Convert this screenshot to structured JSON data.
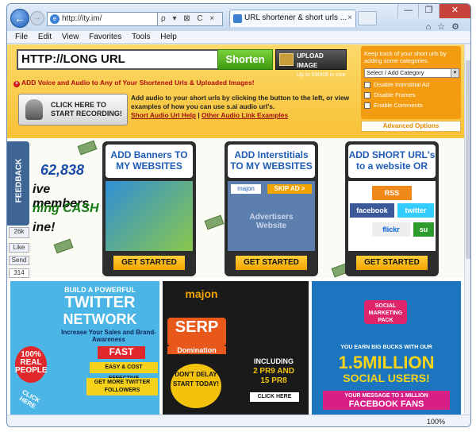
{
  "browser": {
    "address": "http://ity.im/",
    "tab_title": "URL shortener & short urls ...",
    "address_buttons": "ρ ▾ ⊠ C ×",
    "window_controls": [
      "—",
      "❐",
      "✕"
    ],
    "menu": [
      "File",
      "Edit",
      "View",
      "Favorites",
      "Tools",
      "Help"
    ],
    "zoom": "100%"
  },
  "header": {
    "url_input_value": "HTTP://LONG URL",
    "shorten_label": "Shorten",
    "upload_title": "UPLOAD IMAGE",
    "upload_sub": "Up to 500KB in size",
    "add_voice": "ADD Voice and Audio to Any of Your Shortened Urls & Uploaded Images!",
    "record_line1": "CLICK HERE TO",
    "record_line2": "START RECORDING!",
    "audio_text": "Add audio to your short urls by clicking the button to the left, or view examples of how you can use s.ai audio url's.",
    "audio_link1": "Short Audio Url Help",
    "audio_sep": "|",
    "audio_link2": "Other Audio Link Examples",
    "category_intro": "Keep track of your short urls by adding some categories.",
    "category_select": "Select / Add Category",
    "options": [
      "Disable Interstitial Ad",
      "Disable Frames",
      "Enable Comments"
    ],
    "advanced": "Advanced Options"
  },
  "promo": {
    "feedback": "FEEDBACK",
    "members_count": "62,838",
    "members_l2": "ive members",
    "members_l3": "ning CASH",
    "members_l4": "ine!",
    "fb_count": "26k",
    "like": "Like",
    "send": "Send",
    "plus_count": "314",
    "cards": [
      {
        "title": "ADD Banners TO MY WEBSITES",
        "button": "GET STARTED"
      },
      {
        "title": "ADD Interstitials TO MY WEBSITES",
        "button": "GET STARTED",
        "skip": "SKIP AD >",
        "advertisers": "Advertisers Website",
        "majon": "majon"
      },
      {
        "title": "ADD SHORT URL's to a website OR",
        "button": "GET STARTED",
        "logos": [
          "RSS",
          "facebook",
          "twitter",
          "flickr",
          "su"
        ]
      }
    ]
  },
  "ads": {
    "ad1": {
      "l1": "BUILD A POWERFUL",
      "l2": "TWITTER",
      "l3": "NETWORK",
      "l4": "Increase Your Sales and Brand-Awareness",
      "badge1": "100%",
      "badge2": "REAL",
      "badge3": "PEOPLE",
      "fast": "FAST",
      "easy": "EASY & COST EFFECTIVE",
      "more": "GET MORE TWITTER FOLLOWERS",
      "click": "CLICK HERE"
    },
    "ad2": {
      "brand": "majon",
      "serp": "SERP",
      "dom": "Domination",
      "dont": "DON'T DELAY",
      "start": "START TODAY!",
      "incl": "INCLUDING",
      "pr": "2 PR9 AND",
      "pr2": "15 PR8",
      "click": "CLICK HERE"
    },
    "ad3": {
      "badge": "SOCIAL MARKETING PACK",
      "earn": "YOU EARN BIG BUCKS WITH OUR",
      "million": "1.5MILLION",
      "users": "SOCIAL USERS!",
      "msg": "YOUR MESSAGE TO 1 MILLION",
      "fans": "FACEBOOK FANS"
    }
  },
  "colors": {
    "header_yellow": "#f7c236",
    "accent_orange": "#f39c12",
    "brand_blue": "#1e5cb6",
    "link_red": "#9c1010"
  }
}
